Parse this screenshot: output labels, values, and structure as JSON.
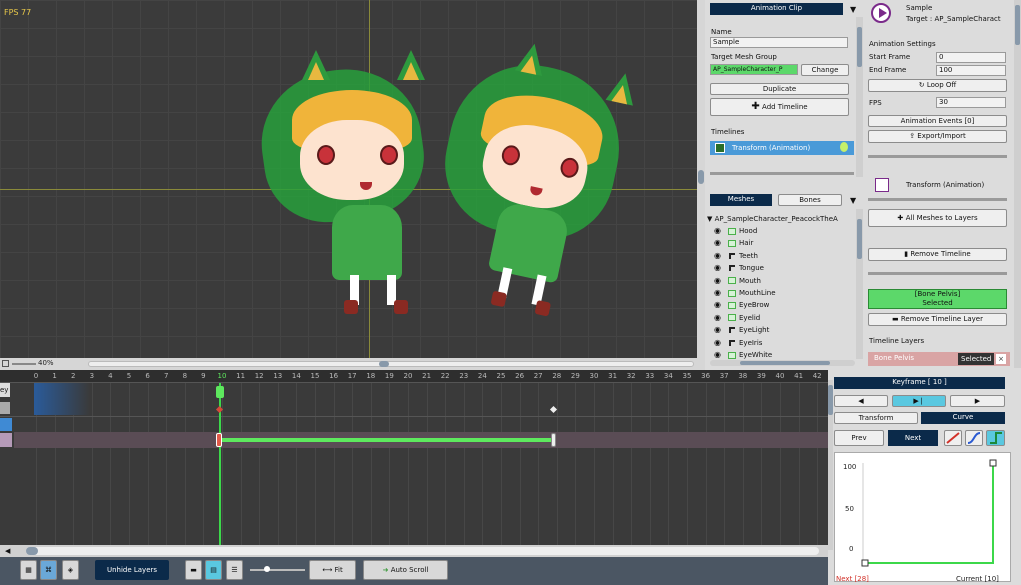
{
  "viewport": {
    "fps": "FPS 77",
    "zoom": "40%"
  },
  "animation_clip": {
    "header": "Animation Clip",
    "name_label": "Name",
    "name_value": "Sample",
    "target_mesh_group_label": "Target Mesh Group",
    "target_mesh_group_value": "AP_SampleCharacter_P",
    "change_label": "Change",
    "duplicate_label": "Duplicate",
    "add_timeline_label": "Add Timeline",
    "timelines_label": "Timelines",
    "timeline_item": "Transform (Animation)"
  },
  "hierarchy": {
    "tabs": [
      "Meshes",
      "Bones"
    ],
    "root": "AP_SampleCharacter_PeacockTheA",
    "items": [
      {
        "label": "Hood",
        "kind": "mesh"
      },
      {
        "label": "Hair",
        "kind": "mesh"
      },
      {
        "label": "Teeth",
        "kind": "bone"
      },
      {
        "label": "Tongue",
        "kind": "bone"
      },
      {
        "label": "Mouth",
        "kind": "mesh"
      },
      {
        "label": "MouthLine",
        "kind": "mesh"
      },
      {
        "label": "EyeBrow",
        "kind": "mesh"
      },
      {
        "label": "Eyelid",
        "kind": "mesh"
      },
      {
        "label": "EyeLight",
        "kind": "bone"
      },
      {
        "label": "EyeIris",
        "kind": "bone"
      },
      {
        "label": "EyeWhite",
        "kind": "mesh"
      }
    ]
  },
  "properties": {
    "title": "Sample",
    "target": "Target : AP_SampleCharact",
    "settings_label": "Animation Settings",
    "start_frame_label": "Start Frame",
    "start_frame": "0",
    "end_frame_label": "End Frame",
    "end_frame": "100",
    "loop_label": "Loop Off",
    "fps_label": "FPS",
    "fps": "30",
    "events_label": "Animation Events [0]",
    "export_label": "Export/Import",
    "timeline_title": "Transform (Animation)",
    "all_meshes_label": "All Meshes to Layers",
    "remove_timeline_label": "Remove Timeline",
    "selected_layer": "[Bone Pelvis]",
    "selected_state": "Selected",
    "remove_layer_label": "Remove Timeline Layer",
    "timeline_layers_label": "Timeline Layers",
    "layer_row_name": "Bone Pelvis",
    "layer_row_state": "Selected",
    "layer_row_close": "×"
  },
  "timeline": {
    "key_tab": "ey",
    "ticks": [
      "0",
      "1",
      "2",
      "3",
      "4",
      "5",
      "6",
      "7",
      "8",
      "9",
      "10",
      "11",
      "12",
      "13",
      "14",
      "15",
      "16",
      "17",
      "18",
      "19",
      "20",
      "21",
      "22",
      "23",
      "24",
      "25",
      "26",
      "27",
      "28",
      "29",
      "30",
      "31",
      "32",
      "33",
      "34",
      "35",
      "36",
      "37",
      "38",
      "39",
      "40",
      "41",
      "42"
    ],
    "current_frame": 10,
    "key_start": 10,
    "key_end": 28
  },
  "toolbar": {
    "unhide_label": "Unhide Layers",
    "fit_label": "Fit",
    "auto_scroll_label": "Auto Scroll"
  },
  "keyframe_panel": {
    "title": "Keyframe [ 10 ]",
    "tab_transform": "Transform",
    "tab_curve": "Curve",
    "prev_label": "Prev",
    "next_label": "Next",
    "y_ticks": [
      "100",
      "50",
      "0"
    ],
    "next_info": "Next [28]",
    "current_info": "Current [10]"
  },
  "colors": {
    "accent": "#0b2a4a",
    "green": "#5cd86a",
    "selection_blue": "#4a9ad8"
  }
}
